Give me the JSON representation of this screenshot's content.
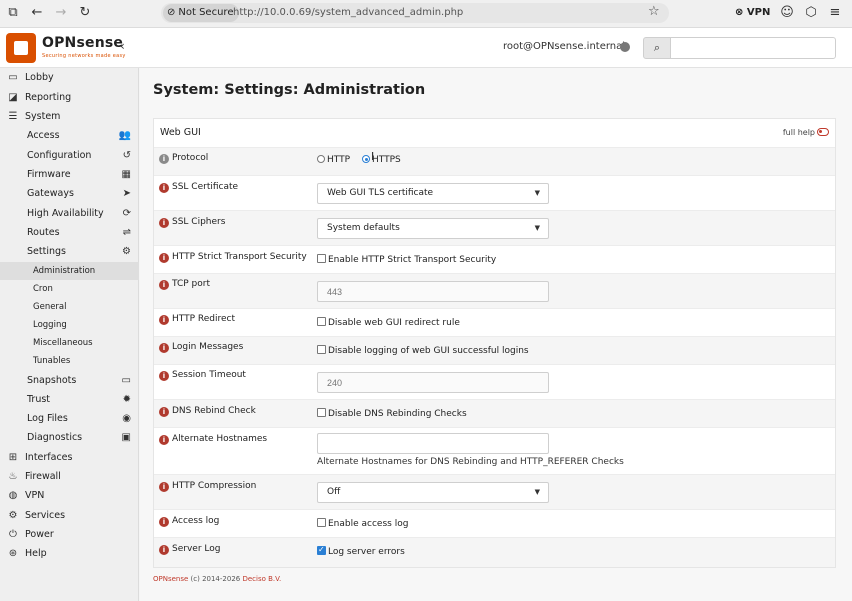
{
  "browser": {
    "not_secure": "Not Secure",
    "url": "http://10.0.0.69/system_advanced_admin.php",
    "vpn": "VPN"
  },
  "header": {
    "logo": "OPNsense",
    "tagline": "Securing networks made easy",
    "user": "root@OPNsense.internal",
    "search_placeholder": ""
  },
  "sidebar": {
    "items": [
      {
        "label": "Lobby",
        "icon": "laptop-icon"
      },
      {
        "label": "Reporting",
        "icon": "chart-icon"
      },
      {
        "label": "System",
        "icon": "server-icon"
      },
      {
        "label": "Access",
        "icon": "users-icon"
      },
      {
        "label": "Configuration",
        "icon": "history-icon"
      },
      {
        "label": "Firmware",
        "icon": "calculator-icon"
      },
      {
        "label": "Gateways",
        "icon": "location-arrow-icon"
      },
      {
        "label": "High Availability",
        "icon": "refresh-icon"
      },
      {
        "label": "Routes",
        "icon": "signpost-icon"
      },
      {
        "label": "Settings",
        "icon": "cogs-icon"
      },
      {
        "label": "Administration"
      },
      {
        "label": "Cron"
      },
      {
        "label": "General"
      },
      {
        "label": "Logging"
      },
      {
        "label": "Miscellaneous"
      },
      {
        "label": "Tunables"
      },
      {
        "label": "Snapshots",
        "icon": "hdd-icon"
      },
      {
        "label": "Trust",
        "icon": "certificate-icon"
      },
      {
        "label": "Log Files",
        "icon": "eye-icon"
      },
      {
        "label": "Diagnostics",
        "icon": "medkit-icon"
      },
      {
        "label": "Interfaces",
        "icon": "sitemap-icon"
      },
      {
        "label": "Firewall",
        "icon": "fire-icon"
      },
      {
        "label": "VPN",
        "icon": "globe-icon"
      },
      {
        "label": "Services",
        "icon": "cog-icon"
      },
      {
        "label": "Power",
        "icon": "plug-icon"
      },
      {
        "label": "Help",
        "icon": "support-icon"
      }
    ]
  },
  "main": {
    "title": "System: Settings: Administration",
    "section": "Web GUI",
    "full_help": "full help",
    "protocol": {
      "label": "Protocol",
      "http": "HTTP",
      "https": "HTTPS",
      "selected": "HTTPS"
    },
    "ssl_certificate": {
      "label": "SSL Certificate",
      "value": "Web GUI TLS certificate"
    },
    "ssl_ciphers": {
      "label": "SSL Ciphers",
      "value": "System defaults"
    },
    "hsts": {
      "label": "HTTP Strict Transport Security",
      "option": "Enable HTTP Strict Transport Security",
      "checked": false
    },
    "tcp_port": {
      "label": "TCP port",
      "placeholder": "443"
    },
    "http_redirect": {
      "label": "HTTP Redirect",
      "option": "Disable web GUI redirect rule",
      "checked": false
    },
    "login_messages": {
      "label": "Login Messages",
      "option": "Disable logging of web GUI successful logins",
      "checked": false
    },
    "session_timeout": {
      "label": "Session Timeout",
      "placeholder": "240"
    },
    "dns_rebind": {
      "label": "DNS Rebind Check",
      "option": "Disable DNS Rebinding Checks",
      "checked": false
    },
    "alt_hostnames": {
      "label": "Alternate Hostnames",
      "value": "",
      "hint": "Alternate Hostnames for DNS Rebinding and HTTP_REFERER Checks"
    },
    "http_compression": {
      "label": "HTTP Compression",
      "value": "Off"
    },
    "access_log": {
      "label": "Access log",
      "option": "Enable access log",
      "checked": false
    },
    "server_log": {
      "label": "Server Log",
      "option": "Log server errors",
      "checked": true
    }
  },
  "footer": {
    "brand": "OPNsense",
    "copyright": " (c) 2014-2026 ",
    "company": "Deciso B.V."
  },
  "colors": {
    "accent": "#d94f00",
    "danger": "#c0392b",
    "check": "#2a7fd4"
  }
}
